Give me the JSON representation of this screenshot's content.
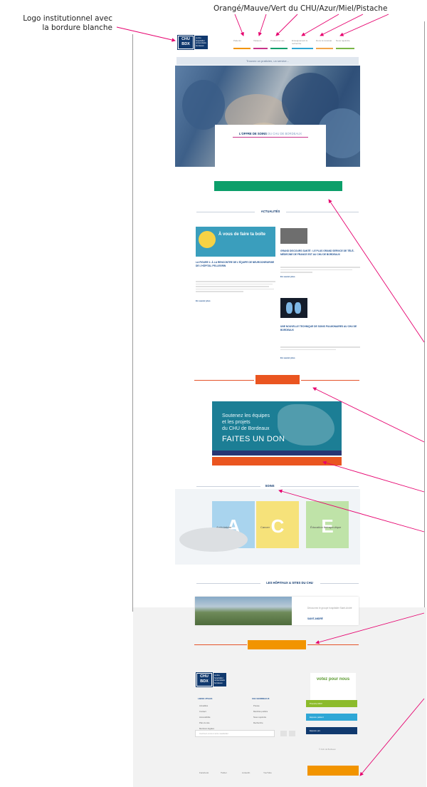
{
  "annotations": {
    "logo_note_line1": "Logo institutionnel avec",
    "logo_note_line2": "la bordure blanche",
    "colors_note": "Orangé/Mauve/Vert du CHU/Azur/Miel/Pistache"
  },
  "colors": {
    "chu_blue": "#10396e",
    "orange": "#f29400",
    "mauve": "#c8358a",
    "green": "#0c9f6a",
    "azure": "#2fa7d6",
    "honey": "#f2a54a",
    "pistachio": "#7ab648",
    "red_orange": "#ea5520",
    "annotation_pink": "#e6006e"
  },
  "header": {
    "logo_text": "CHU BDX",
    "logo_subtext": "centre hospitalier universitaire bordeaux",
    "nav": [
      {
        "label": "Patients",
        "color": "#f29400"
      },
      {
        "label": "Visiteurs",
        "color": "#c8358a"
      },
      {
        "label": "Professionnels",
        "color": "#0c9f6a"
      },
      {
        "label": "Enseignement & recherche",
        "color": "#2fa7d6"
      },
      {
        "label": "Dons & mécénat",
        "color": "#f2a54a"
      },
      {
        "label": "Nous rejoindre",
        "color": "#7ab648"
      }
    ],
    "search_placeholder": "Trouvez un praticien, un service..."
  },
  "hero": {
    "card_title": "L'OFFRE DE SOINS",
    "card_title_accent": "DU CHU DE BORDEAUX"
  },
  "news": {
    "section_title": "ACTUALITÉS",
    "featured": {
      "title": "LA FIGURE 1: À LA RENCONTRE DE L'ÉQUIPE DE NEUROCHIRURGIE DE L'HÔPITAL PELLEGRIN",
      "more": "En savoir plus"
    },
    "items": [
      {
        "title": "GRAND DISCOURS SANTÉ : LE PLUS GRAND SERVICE DE TÉLÉ-MÉDECINE DE FRANCE EST AU CHU DE BORDEAUX",
        "more": "En savoir plus"
      },
      {
        "title": "UNE NOUVELLE TECHNIQUE DE SOINS PULMONAIRES AU CHU DE BORDEAUX",
        "more": "En savoir plus"
      }
    ],
    "featured_image_text": "À vous de faire ta boîte"
  },
  "don": {
    "line1": "Soutenez les équipes",
    "line2": "et les projets",
    "line3": "du CHU de Bordeaux",
    "title": "FAITES UN DON"
  },
  "soins": {
    "section_title": "SOINS",
    "tiles": [
      {
        "letter": "A",
        "label": "Ambulatoire",
        "color": "#a9d4ee"
      },
      {
        "letter": "C",
        "label": "Cancer",
        "color": "#f6e27a"
      },
      {
        "letter": "E",
        "label": "Éducation thérapeutique",
        "color": "#bfe3a8"
      }
    ]
  },
  "hospitals": {
    "section_title": "LES HÔPITAUX & SITES DU CHU",
    "text": "Découvrez le groupe hospitalier Saint-André",
    "link": "SAINT-ANDRÉ"
  },
  "footer": {
    "col1_title": "LIENS UTILES",
    "col1_links": [
      "Actualités",
      "Contact",
      "Accessibilité",
      "Plan du site",
      "Mentions légales"
    ],
    "col2_title": "CHU BORDEAUX",
    "col2_links": [
      "Presse",
      "Marchés publics",
      "Nous rejoindre",
      "Recherche"
    ],
    "buttons": [
      {
        "label": "Prendre RDV",
        "color": "#8cbb2c"
      },
      {
        "label": "Espace patient",
        "color": "#2fa7d6"
      },
      {
        "label": "Espace pro",
        "color": "#10396e"
      }
    ],
    "newsletter_placeholder": "Inscrivez-vous à notre newsletter",
    "badge_text": "votez pour nous",
    "bottom_links": [
      "Facebook",
      "Twitter",
      "LinkedIn",
      "YouTube"
    ],
    "copyright": "© CHU de Bordeaux"
  }
}
